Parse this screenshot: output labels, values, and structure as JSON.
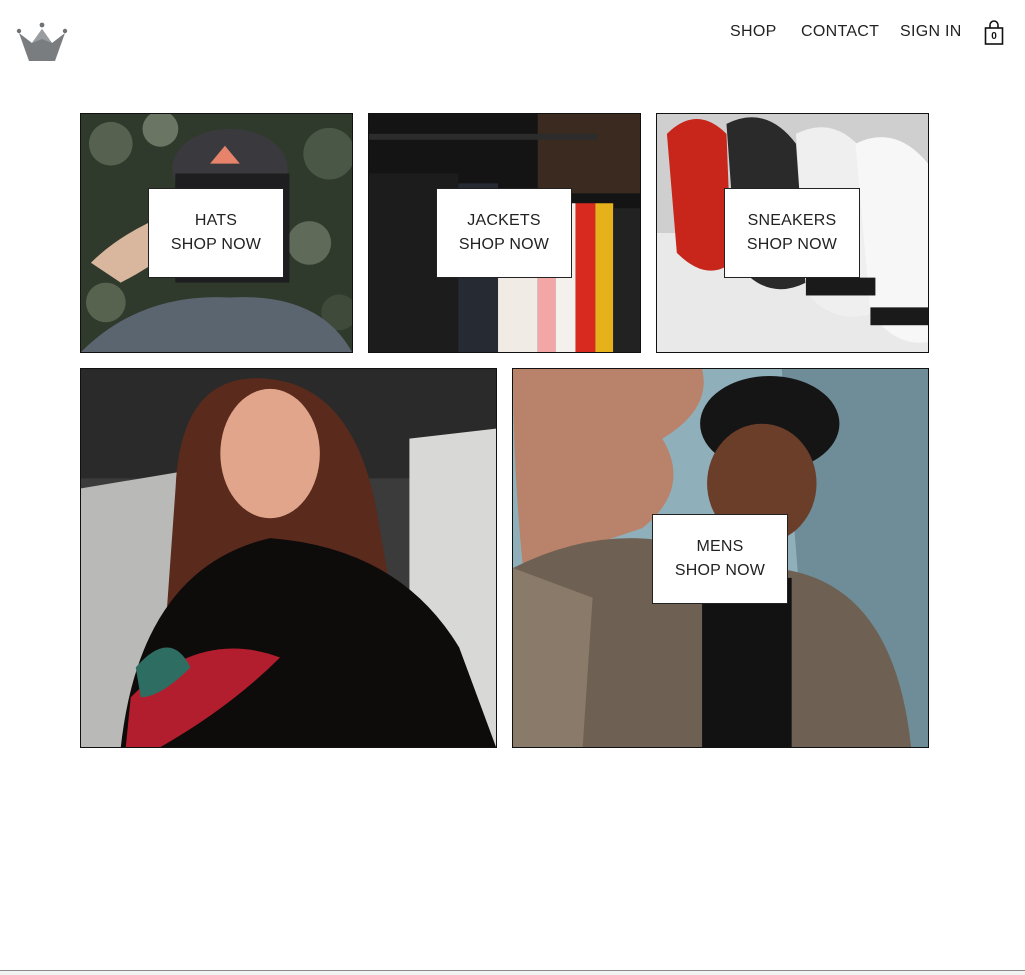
{
  "header": {
    "logo_icon": "crown-icon",
    "nav": {
      "shop": "SHOP",
      "contact": "CONTACT",
      "sign_in": "SIGN IN"
    },
    "cart": {
      "icon": "shopping-bag-icon",
      "count": "0"
    }
  },
  "directory": {
    "hats": {
      "title": "HATS",
      "subtitle": "SHOP NOW"
    },
    "jackets": {
      "title": "JACKETS",
      "subtitle": "SHOP NOW"
    },
    "sneakers": {
      "title": "SNEAKERS",
      "subtitle": "SHOP NOW"
    },
    "womens": {
      "title": "",
      "subtitle": ""
    },
    "mens": {
      "title": "MENS",
      "subtitle": "SHOP NOW"
    }
  },
  "colors": {
    "text": "#222222",
    "border": "#111111",
    "logo": "#7a7d80",
    "background": "#ffffff"
  }
}
